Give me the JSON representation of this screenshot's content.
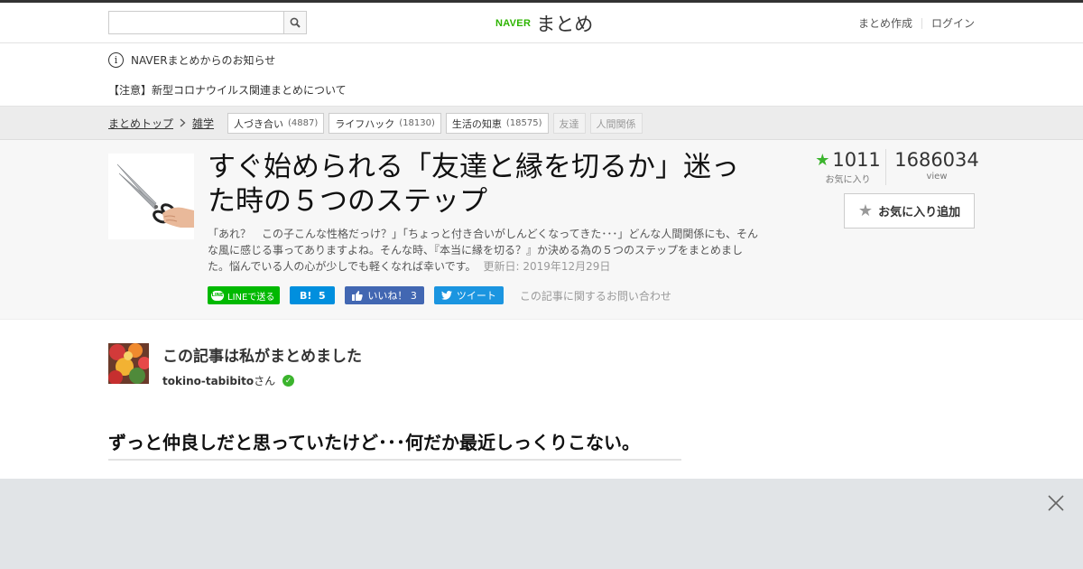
{
  "header": {
    "search_placeholder": "",
    "logo_naver": "NAVER",
    "logo_matome": "まとめ",
    "nav_create": "まとめ作成",
    "nav_login": "ログイン"
  },
  "notice": {
    "heading": "NAVERまとめからのお知らせ",
    "link": "【注意】新型コロナウイルス関連まとめについて"
  },
  "breadcrumb": {
    "top": "まとめトップ",
    "category": "雑学",
    "tags": [
      {
        "label": "人づき合い",
        "count": "(4887)"
      },
      {
        "label": "ライフハック",
        "count": "(18130)"
      },
      {
        "label": "生活の知恵",
        "count": "(18575)"
      },
      {
        "label": "友達",
        "count": ""
      },
      {
        "label": "人間関係",
        "count": ""
      }
    ]
  },
  "article": {
    "title": "すぐ始められる「友達と縁を切るか」迷った時の５つのステップ",
    "description": "「あれ？　この子こんな性格だっけ？」「ちょっと付き合いがしんどくなってきた･･･」どんな人間関係にも、そんな風に感じる事ってありますよね。そんな時、『本当に縁を切る？』か決める為の５つのステップをまとめました。悩んでいる人の心が少しでも軽くなれば幸いです。",
    "updated": "更新日: 2019年12月29日",
    "favorites_count": "1011",
    "favorites_label": "お気に入り",
    "views_count": "1686034",
    "views_label": "view",
    "fav_button": "お気に入り追加"
  },
  "share": {
    "line": "LINEで送る",
    "line_icon": "LINE",
    "hatena_icon": "B!",
    "hatena_count": "5",
    "fb_like": "いいね！",
    "fb_count": "3",
    "tweet": "ツイート",
    "inquiry": "この記事に関するお問い合わせ"
  },
  "author": {
    "heading": "この記事は私がまとめました",
    "name": "tokino-tabibito",
    "suffix": "さん"
  },
  "section": {
    "heading": "ずっと仲良しだと思っていたけど･･･何だか最近しっくりこない。"
  },
  "colors": {
    "naver_green": "#2db400",
    "line_green": "#00b900",
    "hatena_blue": "#008fde",
    "facebook_blue": "#4267b2",
    "twitter_blue": "#1b95e0",
    "star_green": "#3bb42d"
  },
  "icons": {
    "search": "search-icon",
    "info": "info-icon",
    "chevron": "chevron-right-icon",
    "star": "star-icon",
    "close": "close-icon"
  }
}
